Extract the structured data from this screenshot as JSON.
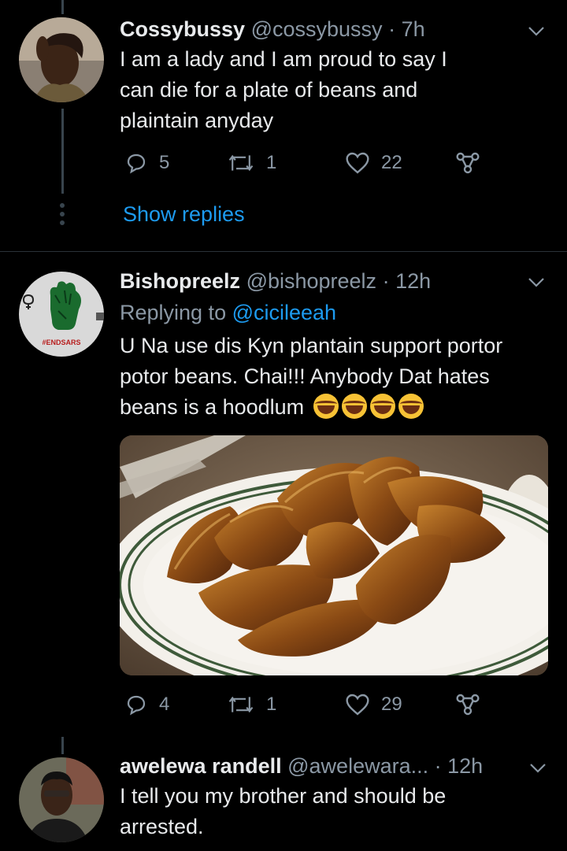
{
  "tweets": [
    {
      "name": "Cossybussy",
      "handle": "@cossybussy",
      "time": "· 7h",
      "text": "I am a lady and I am proud to say I can die for a plate of beans and plaintain anyday",
      "replies": "5",
      "retweets": "1",
      "likes": "22",
      "show_replies": "Show replies"
    },
    {
      "name": "Bishopreelz",
      "handle": "@bishopreelz",
      "time": "· 12h",
      "replying_prefix": "Replying to",
      "replying_to": "@cicileeah",
      "text": "U Na use dis Kyn plantain support portor potor beans. Chai!!! Anybody Dat hates beans is a hoodlum",
      "emoji": "face-with-tears-of-joy-icon",
      "emoji_count": 4,
      "avatar_badge": "#ENDSARS",
      "replies": "4",
      "retweets": "1",
      "likes": "29"
    },
    {
      "name": "awelewa randell",
      "handle": "@awelewara...",
      "time": "· 12h",
      "text": "I tell you my brother and should be arrested."
    }
  ],
  "colors": {
    "background": "#000000",
    "accent_link": "#1d9bf0",
    "muted": "#8b98a5",
    "thread_line": "#38444d"
  }
}
